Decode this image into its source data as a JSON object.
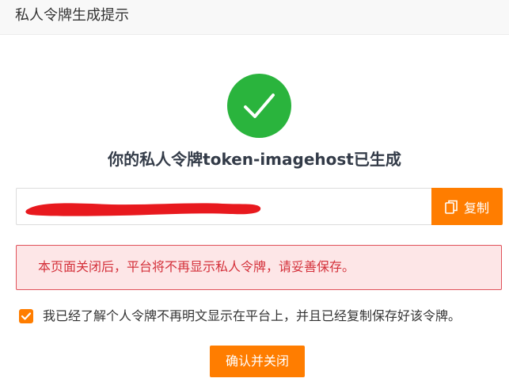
{
  "dialog": {
    "title": "私人令牌生成提示"
  },
  "result": {
    "status_icon": "check-circle-icon",
    "headline": "你的私人令牌token-imagehost已生成"
  },
  "token": {
    "value_hidden_by": "red-redaction-mark",
    "copy_icon": "copy-icon",
    "copy_label": "复制"
  },
  "warning": {
    "text": "本页面关闭后，平台将不再显示私人令牌，请妥善保存。"
  },
  "acknowledge": {
    "checked": true,
    "label": "我已经了解个人令牌不再明文显示在平台上，并且已经复制保存好该令牌。"
  },
  "actions": {
    "confirm_label": "确认并关闭"
  },
  "colors": {
    "accent": "#ff7d00",
    "success": "#2ab43d",
    "warning_text": "#d4313b",
    "warning_bg": "#fde6e7",
    "warning_border": "#e0525a",
    "redaction": "#e8191e"
  }
}
